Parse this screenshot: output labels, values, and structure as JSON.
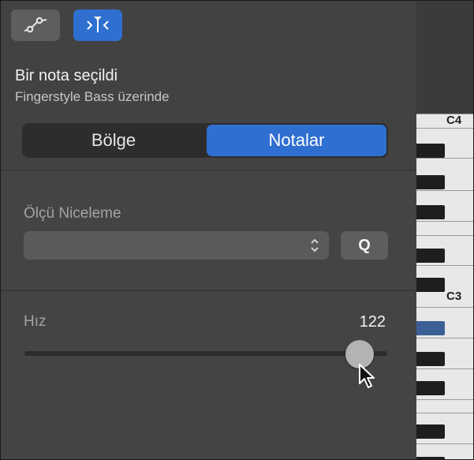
{
  "toolbar": {
    "automation_icon": "automation-curve-icon",
    "inspector_icon": "note-inspector-icon"
  },
  "header": {
    "title": "Bir nota seçildi",
    "subtitle": "Fingerstyle Bass üzerinde"
  },
  "tabs": {
    "region_label": "Bölge",
    "notes_label": "Notalar",
    "selected": "Notalar"
  },
  "quantize": {
    "label": "Ölçü Niceleme",
    "value": "",
    "button_label": "Q"
  },
  "velocity": {
    "label": "Hız",
    "value": "122",
    "max": "127"
  },
  "piano": {
    "labels": [
      "C4",
      "C3"
    ]
  },
  "colors": {
    "accent": "#2f6fd0",
    "selected_key": "#3c5f96"
  }
}
